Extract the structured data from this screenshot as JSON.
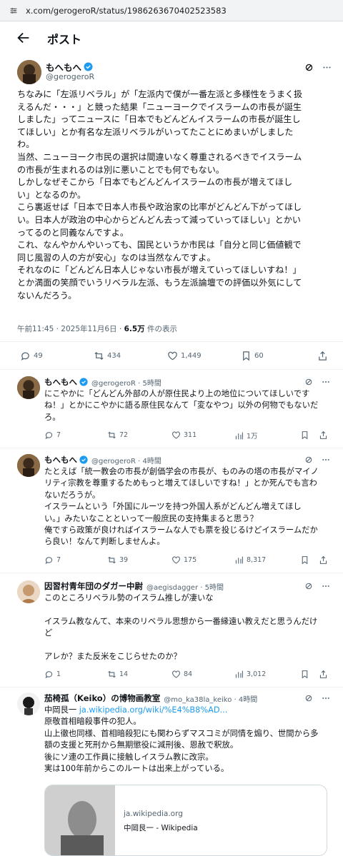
{
  "browser": {
    "url": "x.com/gerogeroR/status/1986263670402523583"
  },
  "header": {
    "title": "ポスト"
  },
  "main_post": {
    "display_name": "もへもへ",
    "handle": "@gerogeroR",
    "lines": [
      "ちなみに「左派リベラル」が「左派内で僕が一番左派と多様性をうまく扱",
      "えるんだ・・・」と競った結果「ニューヨークでイスラームの市長が誕生",
      "しました」ってニュースに「日本でもどんどんイスラームの市長が誕生し",
      "てほしい」とか有名な左派リベラルがいってたことにめまいがしました",
      "わ。",
      "当然、ニューヨーク市民の選択は間違いなく尊重されるべきでイスラーム",
      "の市長が生まれるのは別に悪いことでも何でもない。",
      "しかしなぜそこから「日本でもどんどんイスラームの市長が増えてほし",
      "い」となるのか。",
      "こら裏返せば「日本で日本人市長や政治家の比率がどんどん下がってほし",
      "い。日本人が政治の中心からどんどん去って減っていってほしい」とかい",
      "ってるのと同義なんですよ。",
      "これ、なんやかんやいっても、国民というか市民は「自分と同じ価値観で",
      "同じ風習の人の方が安心」なのは当然なんですよ。",
      "それなのに「どんどん日本人じゃない市長が増えていってほしいすね！」",
      "とか満面の笑顔でいうリベラル左派、もう左派論壇での評価以外気にして",
      "ないんだろう。"
    ],
    "time": "午前11:45 · 2025年11月6日 · ",
    "views_count": "6.5万",
    "views_label": " 件の表示",
    "replies": "49",
    "reposts": "434",
    "likes": "1,449",
    "bookmarks": "60"
  },
  "replies": [
    {
      "display_name": "もへもへ",
      "meta": "@gerogeroR · 5時間",
      "lines": [
        "にこやかに「どんどん外部の人が原住民より上の地位についてほしいです",
        "ね！」とかにこやかに語る原住民なんて「変なやつ」以外の何物でもないだ",
        "ろ。"
      ],
      "replies": "7",
      "reposts": "72",
      "likes": "311",
      "views": "1万"
    },
    {
      "display_name": "もへもへ",
      "meta": "@gerogeroR · 4時間",
      "lines": [
        "たとえば「統一教会の市長が創価学会の市長が、ものみの塔の市長がマイノ",
        "リティ宗教を尊重するためもっと増えてほしいですね！」とか死んでも言わ",
        "ないだろうが。",
        "イスラームという「外国にルーツを持つ外国人系がどんどん増えてほし",
        "い。」みたいなことといって一般庶民の支持集まると思う？",
        "俺ですら政策が良ければイスラームな人でも票を投じるけどイスラームだか",
        "ら良い！なんて判断しませんよ。"
      ],
      "replies": "7",
      "reposts": "39",
      "likes": "175",
      "views": "8,317"
    },
    {
      "display_name": "因習村青年団のダガー中尉",
      "meta": "@aegisdagger · 5時間",
      "lines": [
        "このところリベラル勢のイスラム推しが凄いな",
        "",
        "イスラム教なんて、本来のリベラル思想から一番縁遠い教えだと思うんだけ",
        "ど",
        "",
        "アレか？また反米をこじらせたのか？"
      ],
      "replies": "1",
      "reposts": "14",
      "likes": "84",
      "views": "3,012"
    },
    {
      "display_name": "茄椅孤（Keiko）の博物画教室",
      "meta": "@mo_ka38la_keiko · 4時間",
      "link_prefix": "中岡艮一 ",
      "link": "ja.wikipedia.org/wiki/%E4%B8%AD...",
      "lines": [
        "原敬首相暗殺事件の犯人。",
        "山上徹也同様、首相暗殺犯にも関わらずマスコミが同情を煽り、世間から多",
        "額の支援と死刑から無期懲役に減刑後、恩赦で釈放。",
        "後にソ連の工作員に接触しイスラム教に改宗。",
        "実は100年前からこのルートは出来上がっている。"
      ],
      "card_domain": "ja.wikipedia.org",
      "card_title": "中岡艮一 - Wikipedia"
    }
  ]
}
